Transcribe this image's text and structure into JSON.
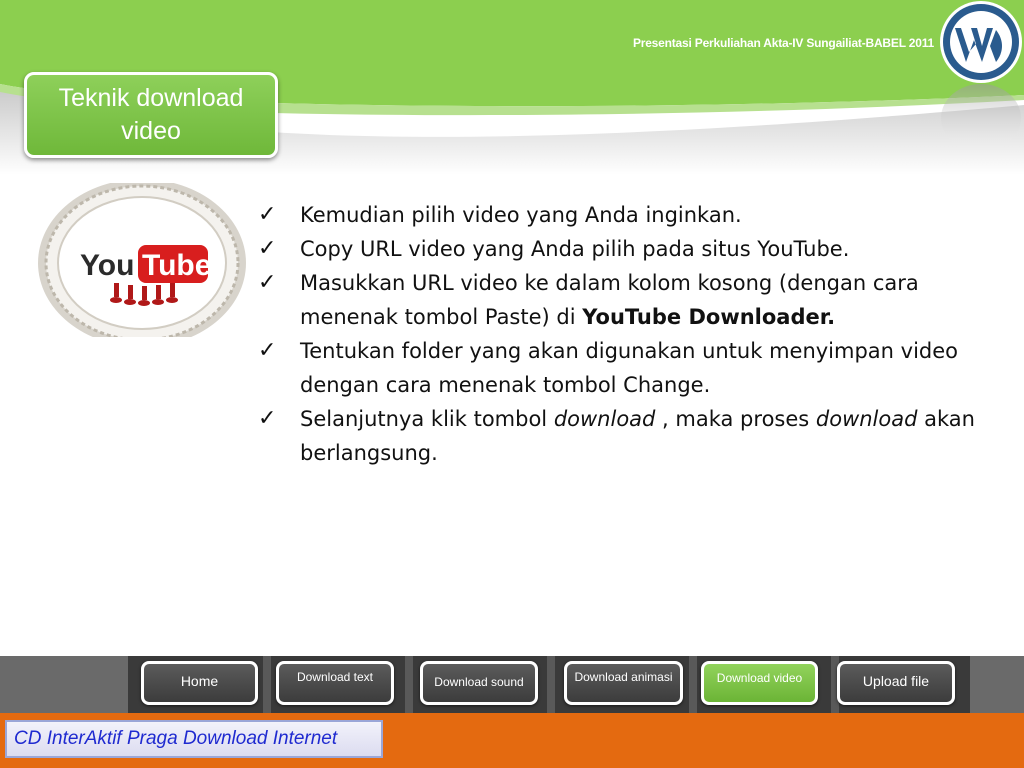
{
  "header": {
    "caption": "Presentasi Perkuliahan Akta-IV Sungailiat-BABEL 2011",
    "logo_icon": "wordpress-logo-icon"
  },
  "slide": {
    "title": "Teknik download video",
    "image_icon": "youtube-cake-image",
    "bullets": [
      {
        "parts": [
          "Kemudian pilih video yang Anda inginkan."
        ]
      },
      {
        "parts": [
          "Copy URL video yang Anda pilih pada situs YouTube."
        ]
      },
      {
        "parts": [
          "Masukkan URL video ke dalam kolom kosong (dengan cara menenak tombol Paste) di ",
          "YouTube Downloader."
        ]
      },
      {
        "parts": [
          "Tentukan folder yang akan digunakan untuk menyimpan video dengan cara menenak tombol Change."
        ]
      },
      {
        "parts": [
          "Selanjutnya klik tombol ",
          "download",
          " , maka proses ",
          "download",
          " akan berlangsung."
        ]
      }
    ]
  },
  "nav": {
    "items": [
      {
        "label": "Home",
        "active": false
      },
      {
        "label": "Download text",
        "active": false
      },
      {
        "label": "Download sound",
        "active": false
      },
      {
        "label": "Download animasi",
        "active": false
      },
      {
        "label": "Download video",
        "active": true
      },
      {
        "label": "Upload file",
        "active": false
      }
    ]
  },
  "footer": {
    "label": "CD InterAktif Praga Download Internet"
  },
  "colors": {
    "header_green": "#8ccf4f",
    "nav_active_green": "#7ec34a",
    "footer_orange": "#e46a10",
    "footer_text_blue": "#1f2ad0"
  }
}
